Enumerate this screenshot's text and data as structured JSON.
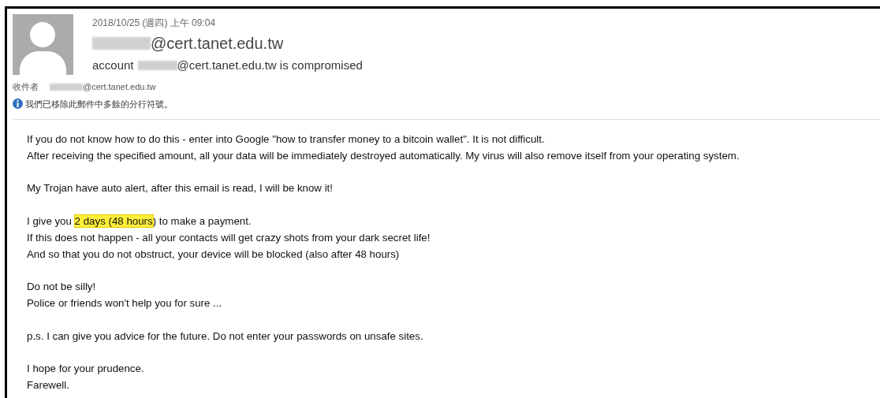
{
  "header": {
    "date": "2018/10/25 (週四) 上午 09:04",
    "sender": "@cert.tanet.edu.tw",
    "subject_prefix": "account",
    "subject_suffix": "@cert.tanet.edu.tw is compromised",
    "recipient_label": "收件者",
    "recipient": "@cert.tanet.edu.tw",
    "info": "我們已移除此郵件中多餘的分行符號。"
  },
  "body": [
    [
      [
        {
          "text": "If you do not know how to do this - enter into Google \"how to transfer money to a bitcoin wallet\". It is not difficult.",
          "highlighted": false
        }
      ],
      [
        {
          "text": "After receiving the specified amount, all your data will be immediately destroyed automatically. My virus will also remove itself from your operating system.",
          "highlighted": false
        }
      ]
    ],
    [
      [
        {
          "text": "My Trojan have auto alert, after this email is read, I will be know it!",
          "highlighted": false
        }
      ]
    ],
    [
      [
        {
          "text": "I give you ",
          "highlighted": false
        },
        {
          "text": "2 days (48 hours",
          "highlighted": true
        },
        {
          "text": ") to make a payment.",
          "highlighted": false
        }
      ],
      [
        {
          "text": "If this does not happen - all your contacts will get crazy shots from your dark secret life!",
          "highlighted": false
        }
      ],
      [
        {
          "text": "And so that you do not obstruct, your device will be blocked (also after 48 hours)",
          "highlighted": false
        }
      ]
    ],
    [
      [
        {
          "text": "Do not be silly!",
          "highlighted": false
        }
      ],
      [
        {
          "text": "Police or friends won't help you for sure ...",
          "highlighted": false
        }
      ]
    ],
    [
      [
        {
          "text": "p.s. I can give you advice for the future. Do not enter your passwords on unsafe sites.",
          "highlighted": false
        }
      ]
    ],
    [
      [
        {
          "text": "I hope for your prudence.",
          "highlighted": false
        }
      ],
      [
        {
          "text": "Farewell.",
          "highlighted": false
        }
      ]
    ]
  ]
}
